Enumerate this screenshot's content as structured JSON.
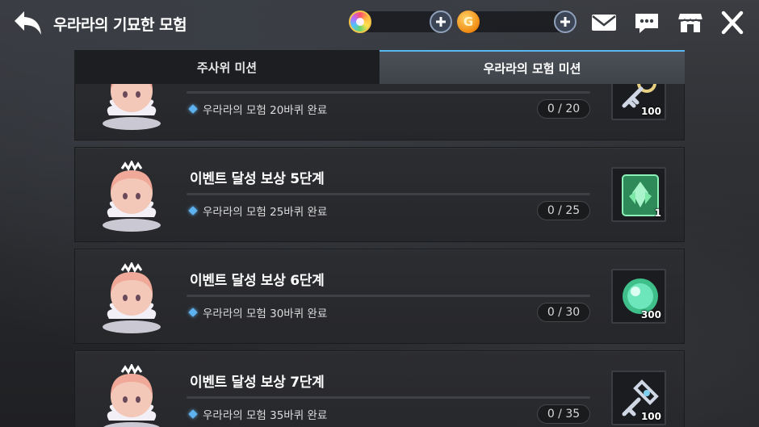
{
  "header": {
    "title": "우라라의 기묘한 모험",
    "back_icon": "back-arrow-icon",
    "currency_icons": [
      "rainbow-gem-icon",
      "gold-coin-icon"
    ],
    "gold_symbol": "G",
    "action_icons": [
      "mail-icon",
      "chat-icon",
      "shop-icon",
      "close-icon"
    ]
  },
  "tabs": [
    {
      "label": "주사위 미션",
      "active": false
    },
    {
      "label": "우라라의 모험 미션",
      "active": true
    }
  ],
  "missions": [
    {
      "title": "",
      "task": "우라라의 모험 20바퀴 완료",
      "progress": "0 / 20",
      "reward_icon": "key-icon",
      "reward_count": "100"
    },
    {
      "title": "이벤트 달성 보상 5단계",
      "task": "우라라의 모험 25바퀴 완료",
      "progress": "0 / 25",
      "reward_icon": "green-crystal-card-icon",
      "reward_count": "1"
    },
    {
      "title": "이벤트 달성 보상 6단계",
      "task": "우라라의 모험 30바퀴 완료",
      "progress": "0 / 30",
      "reward_icon": "green-orb-icon",
      "reward_count": "300"
    },
    {
      "title": "이벤트 달성 보상 7단계",
      "task": "우라라의 모험 35바퀴 완료",
      "progress": "0 / 35",
      "reward_icon": "key-icon",
      "reward_count": "100"
    }
  ],
  "colors": {
    "accent": "#5ab8f0",
    "card": "#2c2d31",
    "tab_inactive": "#1d1e21"
  }
}
